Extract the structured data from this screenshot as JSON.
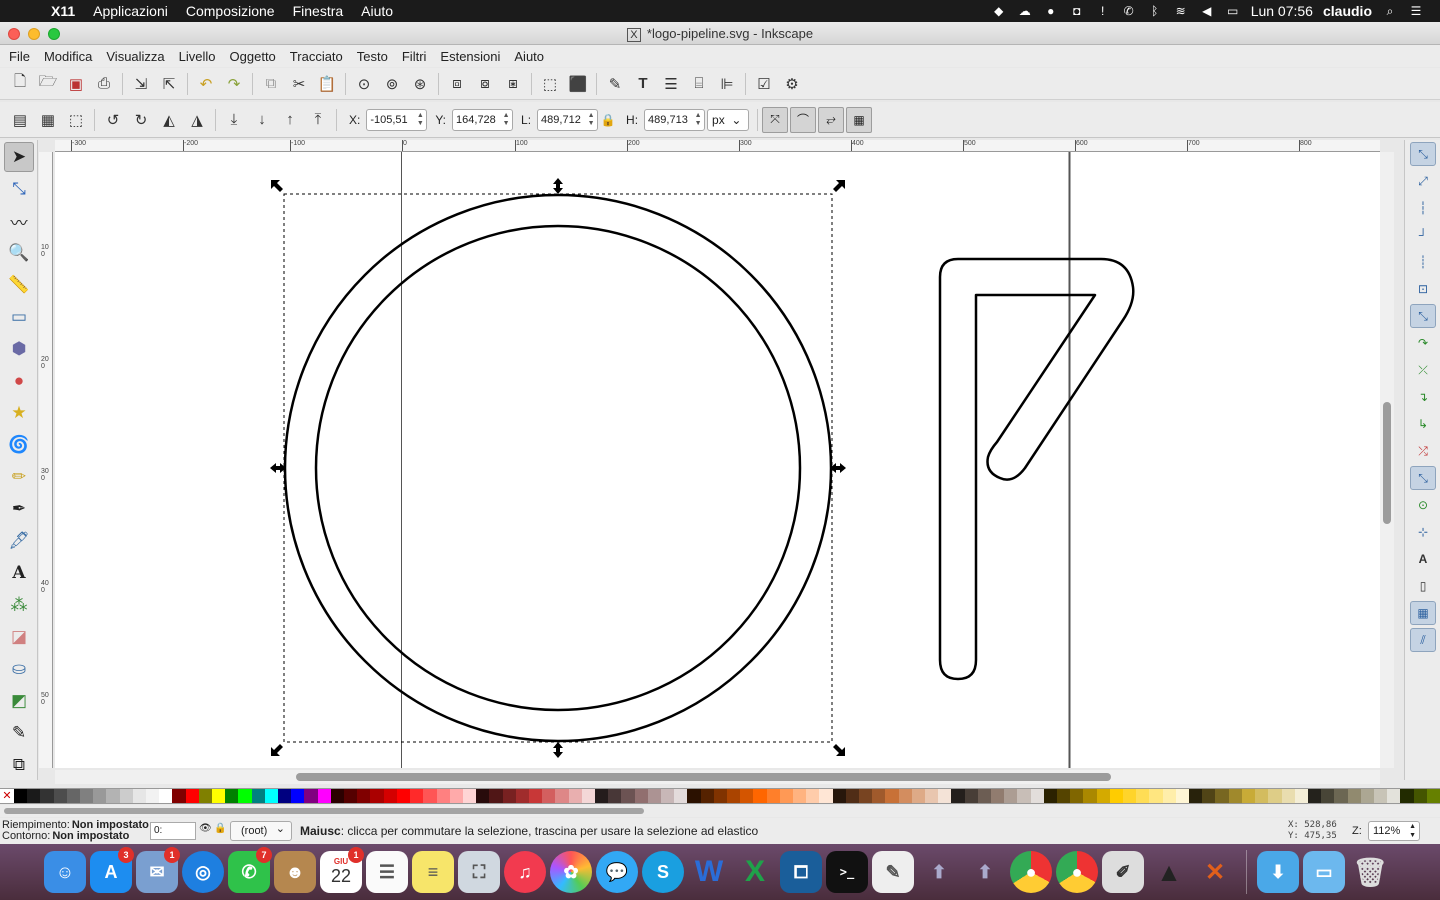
{
  "menubar": {
    "apple": "",
    "items": [
      "X11",
      "Applicazioni",
      "Composizione",
      "Finestra",
      "Aiuto"
    ],
    "clock": "Lun 07:56",
    "user": "claudio"
  },
  "window": {
    "title": "*logo-pipeline.svg - Inkscape",
    "x11_glyph": "X"
  },
  "app_menu": [
    "File",
    "Modifica",
    "Visualizza",
    "Livello",
    "Oggetto",
    "Tracciato",
    "Testo",
    "Filtri",
    "Estensioni",
    "Aiuto"
  ],
  "toolcontrols": {
    "x_label": "X:",
    "x_value": "-105,51",
    "y_label": "Y:",
    "y_value": "164,728",
    "w_label": "L:",
    "w_value": "489,712",
    "h_label": "H:",
    "h_value": "489,713",
    "unit": "px"
  },
  "ruler_h": [
    "-300",
    "-200",
    "-100",
    "0",
    "100",
    "200",
    "300",
    "400",
    "500",
    "600",
    "700",
    "800"
  ],
  "ruler_v": [
    "100",
    "200",
    "300",
    "400",
    "500",
    "600"
  ],
  "statusbar": {
    "fill_label": "Riempimento:",
    "fill_value": "Non impostato",
    "stroke_label": "Contorno:",
    "stroke_value": "Non impostato",
    "opacity": "0:",
    "layer": "(root)",
    "message_key": "Maiusc",
    "message": ": clicca per commutare la selezione, trascina per usare la selezione ad elastico",
    "coord_x": "X: 528,86",
    "coord_y": "Y: 475,35",
    "zoom_label": "Z:",
    "zoom_value": "112%"
  },
  "dock": {
    "badges": {
      "appstore": "3",
      "mail": "1",
      "facetime": "7",
      "calendar": "1"
    },
    "calendar_month": "GIU",
    "calendar_day": "22"
  },
  "colors": {
    "accent_selection": "#000000",
    "palette": [
      "#000000",
      "#1a1a1a",
      "#333333",
      "#4d4d4d",
      "#666666",
      "#808080",
      "#999999",
      "#b3b3b3",
      "#cccccc",
      "#e6e6e6",
      "#f2f2f2",
      "#ffffff",
      "#800000",
      "#ff0000",
      "#808000",
      "#ffff00",
      "#008000",
      "#00ff00",
      "#008080",
      "#00ffff",
      "#000080",
      "#0000ff",
      "#800080",
      "#ff00ff",
      "#2b0000",
      "#550000",
      "#800000",
      "#aa0000",
      "#d40000",
      "#ff0000",
      "#ff2a2a",
      "#ff5555",
      "#ff8080",
      "#ffaaaa",
      "#ffd5d5",
      "#280b0b",
      "#501616",
      "#782121",
      "#a02c2c",
      "#c83737",
      "#d35f5f",
      "#de8787",
      "#e9afaf",
      "#f4d7d7",
      "#241c1c",
      "#483737",
      "#6c5353",
      "#916f6f",
      "#ac9393",
      "#c8b7b7",
      "#e3dbdb",
      "#2b1100",
      "#552200",
      "#803300",
      "#aa4400",
      "#d45500",
      "#ff6600",
      "#ff7f2a",
      "#ff9955",
      "#ffb380",
      "#ffccaa",
      "#ffe6d5",
      "#28170b",
      "#502d16",
      "#784421",
      "#a05a2c",
      "#c87137",
      "#d38d5f",
      "#deaa87",
      "#e9c6af",
      "#f4e3d7",
      "#241f1c",
      "#483e37",
      "#6c5d53",
      "#917c6f",
      "#ac9d93",
      "#c8beb7",
      "#e3dedb",
      "#2b2200",
      "#554400",
      "#806600",
      "#aa8800",
      "#d4aa00",
      "#ffcc00",
      "#ffd42a",
      "#ffdd55",
      "#ffe680",
      "#ffeeaa",
      "#fff6d5",
      "#28220b",
      "#504416",
      "#786721",
      "#a0892c",
      "#c8ab37",
      "#d3bc5f",
      "#decd87",
      "#e9ddaf",
      "#f4eed7",
      "#24221c",
      "#484537",
      "#6c6753",
      "#918a6f",
      "#aca793",
      "#c8c4b7",
      "#e3e2db",
      "#222b00",
      "#445500",
      "#668000"
    ]
  }
}
